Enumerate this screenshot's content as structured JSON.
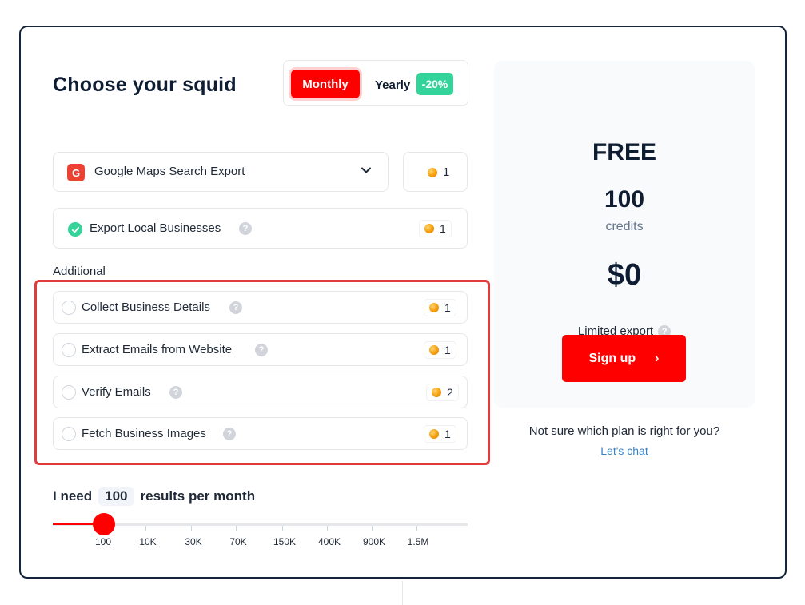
{
  "header": {
    "title": "Choose your squid"
  },
  "billing": {
    "monthly_label": "Monthly",
    "yearly_label": "Yearly",
    "yearly_discount": "-20%",
    "selected": "Monthly"
  },
  "product": {
    "icon": "google-icon",
    "icon_letter": "G",
    "label": "Google Maps Search Export",
    "credits": "1"
  },
  "main_option": {
    "label": "Export Local Businesses",
    "help": "?",
    "credits": "1",
    "checked": true
  },
  "additional": {
    "heading": "Additional",
    "items": [
      {
        "label": "Collect Business Details",
        "help": "?",
        "credits": "1"
      },
      {
        "label": "Extract Emails from Website",
        "help": "?",
        "credits": "1"
      },
      {
        "label": "Verify Emails",
        "help": "?",
        "credits": "2"
      },
      {
        "label": "Fetch Business Images",
        "help": "?",
        "credits": "1"
      }
    ]
  },
  "volume": {
    "prefix": "I need",
    "value": "100",
    "suffix": "results per month",
    "ticks": [
      "100",
      "10K",
      "30K",
      "70K",
      "150K",
      "400K",
      "900K",
      "1.5M"
    ],
    "selected_index": 0
  },
  "plan": {
    "name": "FREE",
    "credits": "100",
    "credits_label": "credits",
    "price": "$0",
    "feature": "Limited export",
    "feature_help": "?",
    "signup_label": "Sign up",
    "signup_arrow": "›"
  },
  "help": {
    "question": "Not sure which plan is right for you?",
    "link": "Let's chat"
  },
  "colors": {
    "accent": "#ff0000",
    "success": "#34d399",
    "frame": "#13253a",
    "highlight": "#e03c3c"
  }
}
